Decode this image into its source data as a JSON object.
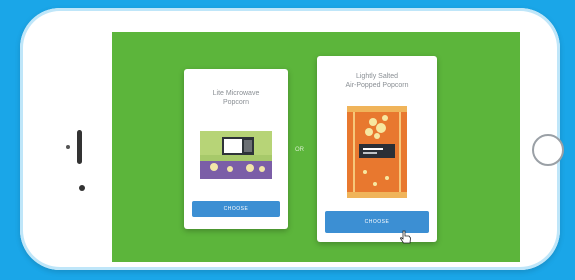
{
  "scene": {
    "background_color": "#1aa6e8",
    "screen_color": "#5cb53b",
    "accent_color": "#3c8fd3"
  },
  "cards": [
    {
      "title": "Lite Microwave\nPopcorn",
      "button_label": "CHOOSE",
      "product_icon": "microwave-popcorn-box-icon"
    },
    {
      "title": "Lightly Salted\nAir-Popped Popcorn",
      "button_label": "CHOOSE",
      "product_icon": "popcorn-bag-icon"
    }
  ],
  "separator_label": "OR",
  "cursor_icon": "hand-pointer-icon"
}
